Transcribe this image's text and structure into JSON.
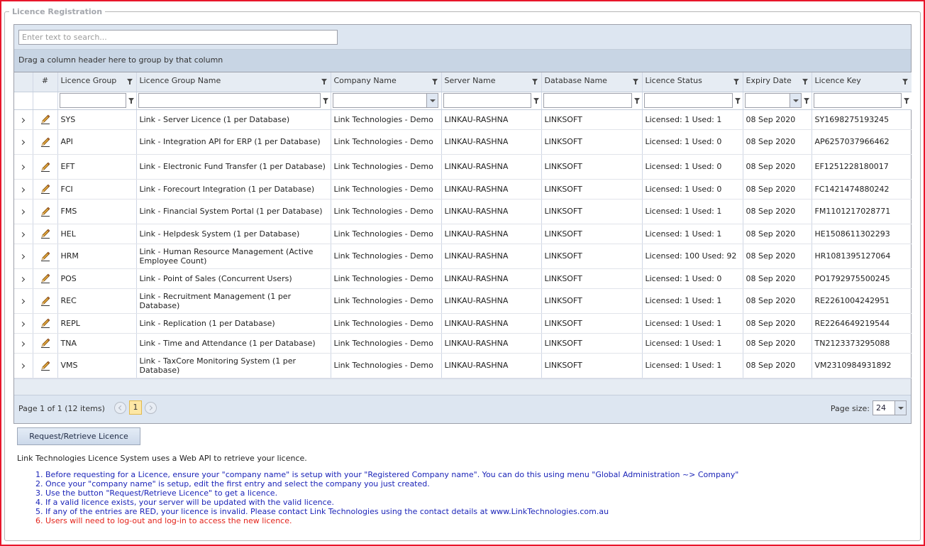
{
  "panel": {
    "title": "Licence Registration"
  },
  "search": {
    "placeholder": "Enter text to search..."
  },
  "group_panel": {
    "text": "Drag a column header here to group by that column"
  },
  "columns": [
    "#",
    "Licence Group",
    "Licence Group Name",
    "Company Name",
    "Server Name",
    "Database Name",
    "Licence Status",
    "Expiry Date",
    "Licence Key"
  ],
  "rows": [
    {
      "group": "SYS",
      "name": "Link - Server Licence (1 per Database)",
      "company": "Link Technologies - Demo",
      "server": "LINKAU-RASHNA",
      "database": "LINKSOFT",
      "status": "Licensed: 1 Used: 1",
      "expiry": "08 Sep 2020",
      "key": "SY1698275193245"
    },
    {
      "group": "API",
      "name": "Link - Integration API for ERP (1 per Database)",
      "company": "Link Technologies - Demo",
      "server": "LINKAU-RASHNA",
      "database": "LINKSOFT",
      "status": "Licensed: 1 Used: 0",
      "expiry": "08 Sep 2020",
      "key": "AP6257037966462"
    },
    {
      "group": "EFT",
      "name": "Link - Electronic Fund Transfer (1 per Database)",
      "company": "Link Technologies - Demo",
      "server": "LINKAU-RASHNA",
      "database": "LINKSOFT",
      "status": "Licensed: 1 Used: 0",
      "expiry": "08 Sep 2020",
      "key": "EF1251228180017"
    },
    {
      "group": "FCI",
      "name": "Link - Forecourt Integration (1 per Database)",
      "company": "Link Technologies - Demo",
      "server": "LINKAU-RASHNA",
      "database": "LINKSOFT",
      "status": "Licensed: 1 Used: 0",
      "expiry": "08 Sep 2020",
      "key": "FC1421474880242"
    },
    {
      "group": "FMS",
      "name": "Link - Financial System Portal (1 per Database)",
      "company": "Link Technologies - Demo",
      "server": "LINKAU-RASHNA",
      "database": "LINKSOFT",
      "status": "Licensed: 1 Used: 1",
      "expiry": "08 Sep 2020",
      "key": "FM1101217028771"
    },
    {
      "group": "HEL",
      "name": "Link - Helpdesk System (1 per Database)",
      "company": "Link Technologies - Demo",
      "server": "LINKAU-RASHNA",
      "database": "LINKSOFT",
      "status": "Licensed: 1 Used: 1",
      "expiry": "08 Sep 2020",
      "key": "HE1508611302293"
    },
    {
      "group": "HRM",
      "name": "Link - Human Resource Management (Active Employee Count)",
      "company": "Link Technologies - Demo",
      "server": "LINKAU-RASHNA",
      "database": "LINKSOFT",
      "status": "Licensed: 100 Used: 92",
      "expiry": "08 Sep 2020",
      "key": "HR1081395127064"
    },
    {
      "group": "POS",
      "name": "Link - Point of Sales (Concurrent Users)",
      "company": "Link Technologies - Demo",
      "server": "LINKAU-RASHNA",
      "database": "LINKSOFT",
      "status": "Licensed: 1 Used: 0",
      "expiry": "08 Sep 2020",
      "key": "PO1792975500245"
    },
    {
      "group": "REC",
      "name": "Link - Recruitment Management (1 per Database)",
      "company": "Link Technologies - Demo",
      "server": "LINKAU-RASHNA",
      "database": "LINKSOFT",
      "status": "Licensed: 1 Used: 1",
      "expiry": "08 Sep 2020",
      "key": "RE2261004242951"
    },
    {
      "group": "REPL",
      "name": "Link - Replication (1 per Database)",
      "company": "Link Technologies - Demo",
      "server": "LINKAU-RASHNA",
      "database": "LINKSOFT",
      "status": "Licensed: 1 Used: 1",
      "expiry": "08 Sep 2020",
      "key": "RE2264649219544"
    },
    {
      "group": "TNA",
      "name": "Link - Time and Attendance (1 per Database)",
      "company": "Link Technologies - Demo",
      "server": "LINKAU-RASHNA",
      "database": "LINKSOFT",
      "status": "Licensed: 1 Used: 1",
      "expiry": "08 Sep 2020",
      "key": "TN2123373295088"
    },
    {
      "group": "VMS",
      "name": "Link - TaxCore Monitoring System (1 per Database)",
      "company": "Link Technologies - Demo",
      "server": "LINKAU-RASHNA",
      "database": "LINKSOFT",
      "status": "Licensed: 1 Used: 1",
      "expiry": "08 Sep 2020",
      "key": "VM2310984931892"
    }
  ],
  "pager": {
    "summary": "Page 1 of 1 (12 items)",
    "current_page": "1",
    "size_label": "Page size:",
    "size_value": "24"
  },
  "request_button": {
    "label": "Request/Retrieve Licence"
  },
  "info_text": "Link Technologies Licence System uses a Web API to retrieve your licence.",
  "instructions": [
    "Before requesting for a Licence, ensure your \"company name\" is setup with your \"Registered Company name\". You can do this using menu \"Global Administration ~> Company\"",
    "Once your \"company name\" is setup, edit the first entry and select the company you just created.",
    "Use the button \"Request/Retrieve Licence\" to get a licence.",
    "If a valid licence exists, your server will be updated with the valid licence.",
    "If any of the entries are RED, your licence is invalid. Please contact Link Technologies using the contact details at www.LinkTechnologies.com.au",
    "Users will need to log-out and log-in to access the new licence."
  ],
  "colors": {
    "frame": "#e8162b",
    "instruction": "#1b24b8",
    "warning": "#e3241b",
    "page_active": "#fde7a5"
  },
  "icons": {
    "row_expand": "chevron-right-icon",
    "row_edit": "pencil-icon",
    "column_filter": "filter-icon"
  }
}
